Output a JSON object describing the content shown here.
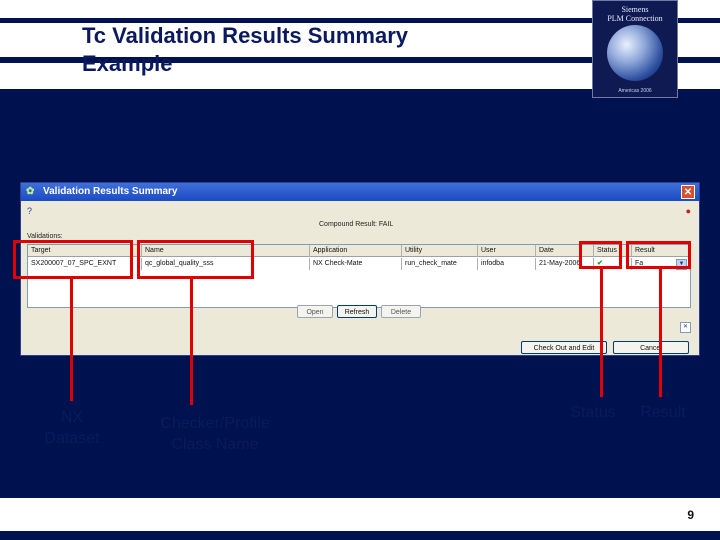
{
  "slide": {
    "title": "Tc Validation Results Summary\nExample",
    "page_number": "9",
    "logo": {
      "text": "Siemens\nPLM Connection",
      "year": "Americas 2006",
      "icon": "globe-icon"
    }
  },
  "window": {
    "title": "Validation Results Summary",
    "close_glyph": "✕",
    "help_glyph": "?",
    "warn_glyph": "●",
    "compound_result": "Compound Result: FAIL",
    "validations_label": "Validations:",
    "columns": [
      "Target",
      "Name",
      "Application",
      "Utility",
      "User",
      "Date",
      "Status",
      "Result"
    ],
    "row": [
      "SX200007_07_SPC_EXNT",
      "qc_global_quality_sss",
      "NX Check-Mate",
      "run_check_mate",
      "infodba",
      "21-May-2006",
      "✔",
      "Fa"
    ],
    "buttons": {
      "open": "Open",
      "refresh": "Refresh",
      "delete": "Delete",
      "checkout": "Check Out and Edit",
      "cancel": "Cancel"
    }
  },
  "callouts": {
    "nx_dataset": "NX\nDataset",
    "checker": "Checker/Profile\nClass Name",
    "status": "Status",
    "result": "Result"
  },
  "colors": {
    "background": "#00114f",
    "highlight": "#e00000",
    "title": "#0b1a5e"
  }
}
